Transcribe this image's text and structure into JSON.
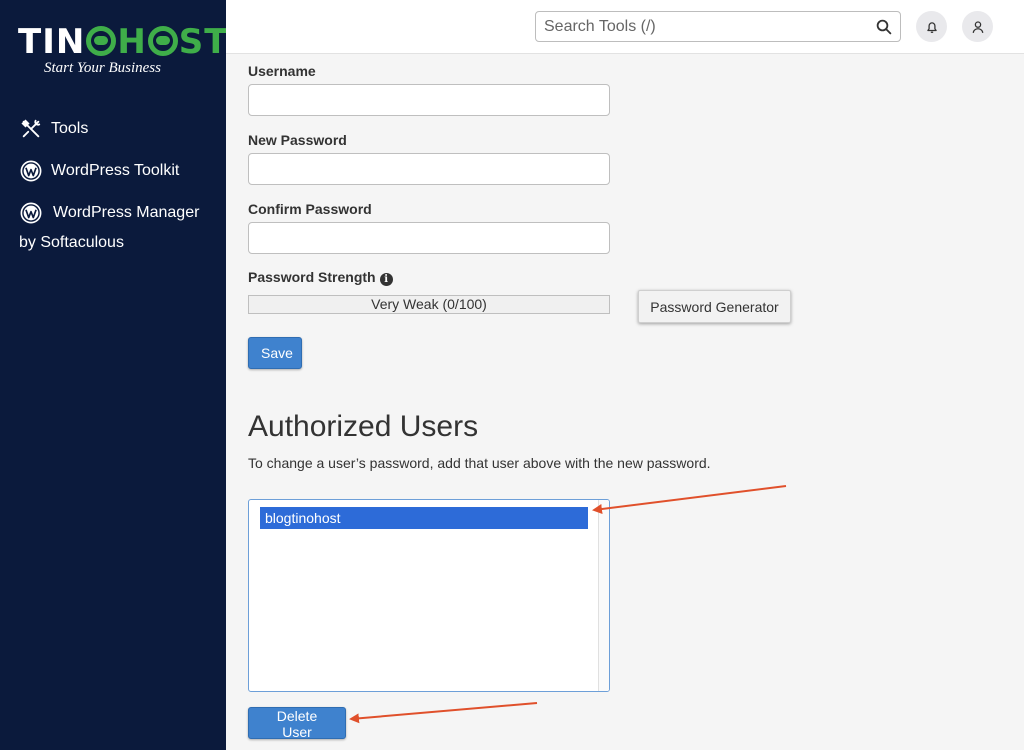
{
  "brand": {
    "name_part1": "TIN",
    "name_part2": "H",
    "name_part3": "ST",
    "tagline": "Start Your Business",
    "colors": {
      "sidebar": "#0b1a3c",
      "green": "#3fae49",
      "primary": "#3f82ce",
      "arrow": "#e0502b"
    }
  },
  "sidebar": {
    "items": [
      {
        "label": "Tools",
        "icon": "tools-icon"
      },
      {
        "label": "WordPress Toolkit",
        "icon": "wordpress-icon"
      },
      {
        "label": "WordPress Manager",
        "label2": "by Softaculous",
        "icon": "wordpress-icon"
      }
    ]
  },
  "topbar": {
    "search_placeholder": "Search Tools (/)"
  },
  "form": {
    "username_label": "Username",
    "username_value": "",
    "new_password_label": "New Password",
    "new_password_value": "",
    "confirm_password_label": "Confirm Password",
    "confirm_password_value": "",
    "strength_label": "Password Strength",
    "strength_text": "Very Weak (0/100)",
    "strength_value": 0,
    "generator_label": "Password Generator",
    "save_label": "Save"
  },
  "authorized": {
    "title": "Authorized Users",
    "description": "To change a user’s password, add that user above with the new password.",
    "users": [
      "blogtinohost"
    ],
    "selected_user": "blogtinohost",
    "delete_label": "Delete User"
  }
}
